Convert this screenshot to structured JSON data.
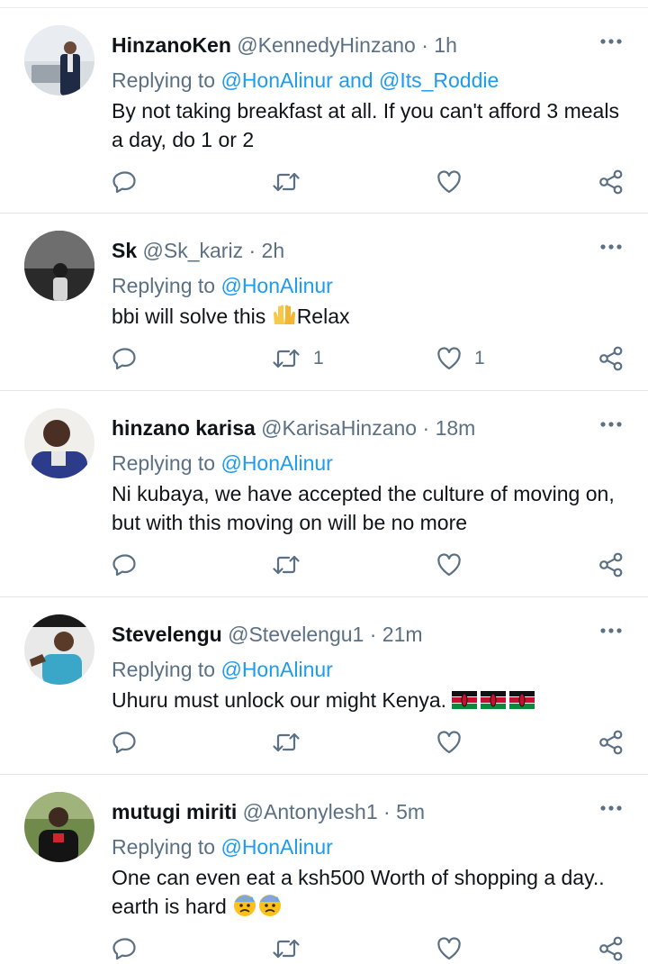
{
  "replying_label": "Replying to",
  "tweets": [
    {
      "name": "HinzanoKen",
      "handle": "@KennedyHinzano",
      "time": "1h",
      "reply_to": "@HonAlinur and @Its_Roddie",
      "body": "By not taking breakfast at all. If you can't afford 3 meals a day, do 1 or 2",
      "retweets": "",
      "likes": ""
    },
    {
      "name": "Sk",
      "handle": "@Sk_kariz",
      "time": "2h",
      "reply_to": "@HonAlinur",
      "body_before_emoji": "bbi will solve this ",
      "body_emoji": "raising-hands-emoji",
      "body_after_emoji": "Relax",
      "retweets": "1",
      "likes": "1"
    },
    {
      "name": "hinzano karisa",
      "handle": "@KarisaHinzano",
      "time": "18m",
      "reply_to": "@HonAlinur",
      "body": "Ni kubaya, we have accepted the culture of moving on, but with this moving on will be no more",
      "retweets": "",
      "likes": ""
    },
    {
      "name": "Stevelengu",
      "handle": "@Stevelengu1",
      "time": "21m",
      "reply_to": "@HonAlinur",
      "body": "Uhuru must unlock our might Kenya. ",
      "body_emoji": "kenya-flag-emoji x3",
      "retweets": "",
      "likes": ""
    },
    {
      "name": "mutugi miriti",
      "handle": "@Antonylesh1",
      "time": "5m",
      "reply_to": "@HonAlinur",
      "body": "One can even eat a ksh500 Worth of shopping a day.. earth is hard ",
      "body_emoji": "anxious-face-with-sweat-emoji x2",
      "retweets": "",
      "likes": ""
    }
  ],
  "colors": {
    "name": "#0f1419",
    "muted": "#5b7083",
    "mention": "#1d9bf0",
    "divider": "#e1e5e8"
  },
  "icons": [
    "reply-icon",
    "retweet-icon",
    "like-icon",
    "share-icon",
    "more-options-icon"
  ]
}
